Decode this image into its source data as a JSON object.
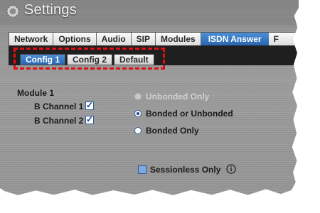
{
  "title": "Settings",
  "main_tabs": [
    {
      "label": "Network",
      "active": false
    },
    {
      "label": "Options",
      "active": false
    },
    {
      "label": "Audio",
      "active": false
    },
    {
      "label": "SIP",
      "active": false
    },
    {
      "label": "Modules",
      "active": false
    },
    {
      "label": "ISDN Answer",
      "active": true
    },
    {
      "label": "F",
      "active": false
    }
  ],
  "sub_tabs": [
    {
      "label": "Config 1",
      "active": true
    },
    {
      "label": "Config 2",
      "active": false
    },
    {
      "label": "Default",
      "active": false
    }
  ],
  "module": {
    "title": "Module 1",
    "b_channel_1": {
      "label": "B Channel 1",
      "checked": true
    },
    "b_channel_2": {
      "label": "B Channel 2",
      "checked": true
    }
  },
  "bonding_options": [
    {
      "label": "Unbonded Only",
      "selected": false,
      "disabled": true
    },
    {
      "label": "Bonded or Unbonded",
      "selected": true,
      "disabled": false
    },
    {
      "label": "Bonded Only",
      "selected": false,
      "disabled": false
    }
  ],
  "sessionless": {
    "label": "Sessionless Only",
    "checked": false
  },
  "check_mark": "✓",
  "colors": {
    "accent": "#2f74c7",
    "highlight": "#e01010"
  }
}
